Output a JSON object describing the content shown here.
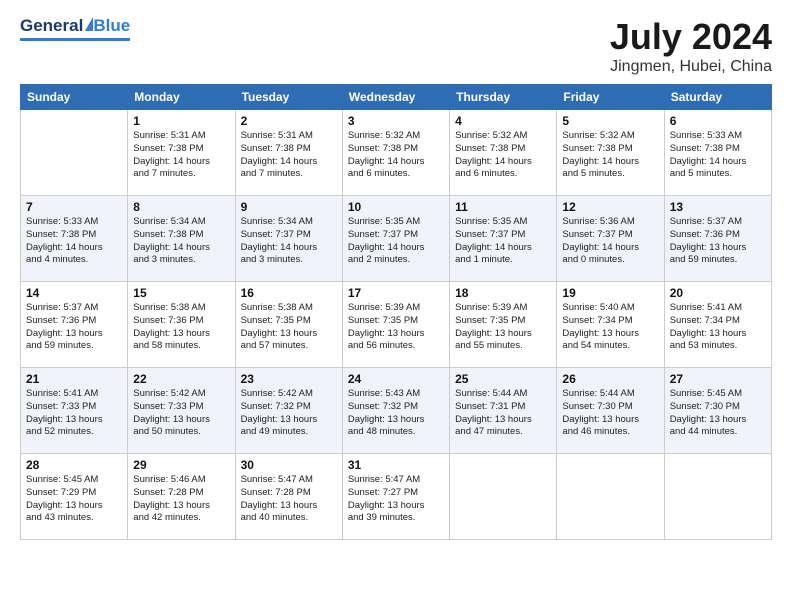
{
  "header": {
    "logo": {
      "general": "General",
      "blue": "Blue",
      "underline": true
    },
    "title": "July 2024",
    "subtitle": "Jingmen, Hubei, China"
  },
  "days_of_week": [
    "Sunday",
    "Monday",
    "Tuesday",
    "Wednesday",
    "Thursday",
    "Friday",
    "Saturday"
  ],
  "weeks": [
    [
      {
        "day": "",
        "date": "",
        "info": ""
      },
      {
        "day": "1",
        "info": "Sunrise: 5:31 AM\nSunset: 7:38 PM\nDaylight: 14 hours\nand 7 minutes."
      },
      {
        "day": "2",
        "info": "Sunrise: 5:31 AM\nSunset: 7:38 PM\nDaylight: 14 hours\nand 7 minutes."
      },
      {
        "day": "3",
        "info": "Sunrise: 5:32 AM\nSunset: 7:38 PM\nDaylight: 14 hours\nand 6 minutes."
      },
      {
        "day": "4",
        "info": "Sunrise: 5:32 AM\nSunset: 7:38 PM\nDaylight: 14 hours\nand 6 minutes."
      },
      {
        "day": "5",
        "info": "Sunrise: 5:32 AM\nSunset: 7:38 PM\nDaylight: 14 hours\nand 5 minutes."
      },
      {
        "day": "6",
        "info": "Sunrise: 5:33 AM\nSunset: 7:38 PM\nDaylight: 14 hours\nand 5 minutes."
      }
    ],
    [
      {
        "day": "7",
        "info": "Sunrise: 5:33 AM\nSunset: 7:38 PM\nDaylight: 14 hours\nand 4 minutes."
      },
      {
        "day": "8",
        "info": "Sunrise: 5:34 AM\nSunset: 7:38 PM\nDaylight: 14 hours\nand 3 minutes."
      },
      {
        "day": "9",
        "info": "Sunrise: 5:34 AM\nSunset: 7:37 PM\nDaylight: 14 hours\nand 3 minutes."
      },
      {
        "day": "10",
        "info": "Sunrise: 5:35 AM\nSunset: 7:37 PM\nDaylight: 14 hours\nand 2 minutes."
      },
      {
        "day": "11",
        "info": "Sunrise: 5:35 AM\nSunset: 7:37 PM\nDaylight: 14 hours\nand 1 minute."
      },
      {
        "day": "12",
        "info": "Sunrise: 5:36 AM\nSunset: 7:37 PM\nDaylight: 14 hours\nand 0 minutes."
      },
      {
        "day": "13",
        "info": "Sunrise: 5:37 AM\nSunset: 7:36 PM\nDaylight: 13 hours\nand 59 minutes."
      }
    ],
    [
      {
        "day": "14",
        "info": "Sunrise: 5:37 AM\nSunset: 7:36 PM\nDaylight: 13 hours\nand 59 minutes."
      },
      {
        "day": "15",
        "info": "Sunrise: 5:38 AM\nSunset: 7:36 PM\nDaylight: 13 hours\nand 58 minutes."
      },
      {
        "day": "16",
        "info": "Sunrise: 5:38 AM\nSunset: 7:35 PM\nDaylight: 13 hours\nand 57 minutes."
      },
      {
        "day": "17",
        "info": "Sunrise: 5:39 AM\nSunset: 7:35 PM\nDaylight: 13 hours\nand 56 minutes."
      },
      {
        "day": "18",
        "info": "Sunrise: 5:39 AM\nSunset: 7:35 PM\nDaylight: 13 hours\nand 55 minutes."
      },
      {
        "day": "19",
        "info": "Sunrise: 5:40 AM\nSunset: 7:34 PM\nDaylight: 13 hours\nand 54 minutes."
      },
      {
        "day": "20",
        "info": "Sunrise: 5:41 AM\nSunset: 7:34 PM\nDaylight: 13 hours\nand 53 minutes."
      }
    ],
    [
      {
        "day": "21",
        "info": "Sunrise: 5:41 AM\nSunset: 7:33 PM\nDaylight: 13 hours\nand 52 minutes."
      },
      {
        "day": "22",
        "info": "Sunrise: 5:42 AM\nSunset: 7:33 PM\nDaylight: 13 hours\nand 50 minutes."
      },
      {
        "day": "23",
        "info": "Sunrise: 5:42 AM\nSunset: 7:32 PM\nDaylight: 13 hours\nand 49 minutes."
      },
      {
        "day": "24",
        "info": "Sunrise: 5:43 AM\nSunset: 7:32 PM\nDaylight: 13 hours\nand 48 minutes."
      },
      {
        "day": "25",
        "info": "Sunrise: 5:44 AM\nSunset: 7:31 PM\nDaylight: 13 hours\nand 47 minutes."
      },
      {
        "day": "26",
        "info": "Sunrise: 5:44 AM\nSunset: 7:30 PM\nDaylight: 13 hours\nand 46 minutes."
      },
      {
        "day": "27",
        "info": "Sunrise: 5:45 AM\nSunset: 7:30 PM\nDaylight: 13 hours\nand 44 minutes."
      }
    ],
    [
      {
        "day": "28",
        "info": "Sunrise: 5:45 AM\nSunset: 7:29 PM\nDaylight: 13 hours\nand 43 minutes."
      },
      {
        "day": "29",
        "info": "Sunrise: 5:46 AM\nSunset: 7:28 PM\nDaylight: 13 hours\nand 42 minutes."
      },
      {
        "day": "30",
        "info": "Sunrise: 5:47 AM\nSunset: 7:28 PM\nDaylight: 13 hours\nand 40 minutes."
      },
      {
        "day": "31",
        "info": "Sunrise: 5:47 AM\nSunset: 7:27 PM\nDaylight: 13 hours\nand 39 minutes."
      },
      {
        "day": "",
        "info": ""
      },
      {
        "day": "",
        "info": ""
      },
      {
        "day": "",
        "info": ""
      }
    ]
  ]
}
